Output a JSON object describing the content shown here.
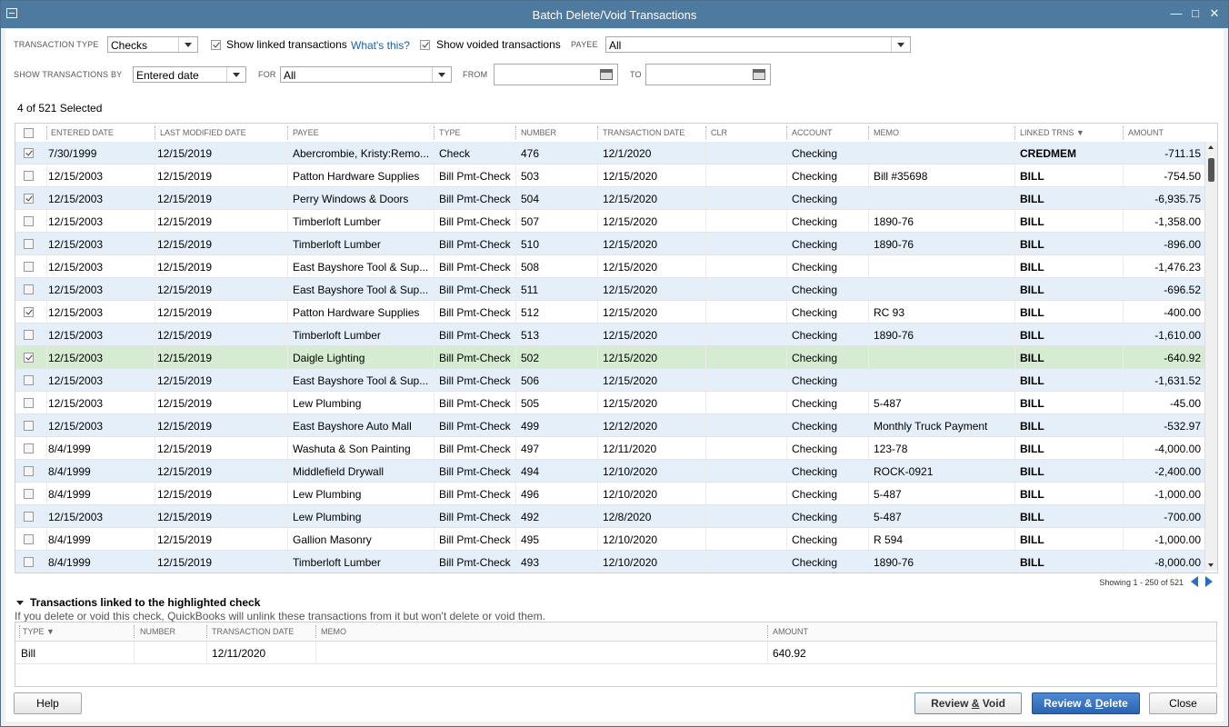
{
  "window": {
    "title": "Batch Delete/Void Transactions"
  },
  "filters": {
    "transaction_type_label": "TRANSACTION TYPE",
    "transaction_type_value": "Checks",
    "show_linked_label": "Show linked transactions",
    "show_linked_checked": true,
    "whats_this": "What's this?",
    "show_voided_label": "Show voided transactions",
    "show_voided_checked": true,
    "payee_label": "PAYEE",
    "payee_value": "All",
    "show_by_label": "SHOW TRANSACTIONS BY",
    "show_by_value": "Entered date",
    "for_label": "FOR",
    "for_value": "All",
    "from_label": "FROM",
    "from_value": "",
    "to_label": "TO",
    "to_value": ""
  },
  "selection_count": "4 of 521 Selected",
  "grid": {
    "headers": [
      "ENTERED DATE",
      "LAST MODIFIED DATE",
      "PAYEE",
      "TYPE",
      "NUMBER",
      "TRANSACTION DATE",
      "CLR",
      "ACCOUNT",
      "MEMO",
      "LINKED TRNS ▼",
      "AMOUNT"
    ],
    "rows": [
      {
        "checked": true,
        "entered": "7/30/1999",
        "modified": "12/15/2019",
        "payee": "Abercrombie, Kristy:Remo...",
        "type": "Check",
        "number": "476",
        "tdate": "12/1/2020",
        "clr": "",
        "account": "Checking",
        "memo": "",
        "linked": "CREDMEM",
        "amount": "-711.15"
      },
      {
        "checked": false,
        "entered": "12/15/2003",
        "modified": "12/15/2019",
        "payee": "Patton Hardware Supplies",
        "type": "Bill Pmt-Check",
        "number": "503",
        "tdate": "12/15/2020",
        "clr": "",
        "account": "Checking",
        "memo": "Bill #35698",
        "linked": "BILL",
        "amount": "-754.50"
      },
      {
        "checked": true,
        "entered": "12/15/2003",
        "modified": "12/15/2019",
        "payee": "Perry Windows & Doors",
        "type": "Bill Pmt-Check",
        "number": "504",
        "tdate": "12/15/2020",
        "clr": "",
        "account": "Checking",
        "memo": "",
        "linked": "BILL",
        "amount": "-6,935.75"
      },
      {
        "checked": false,
        "entered": "12/15/2003",
        "modified": "12/15/2019",
        "payee": "Timberloft Lumber",
        "type": "Bill Pmt-Check",
        "number": "507",
        "tdate": "12/15/2020",
        "clr": "",
        "account": "Checking",
        "memo": "1890-76",
        "linked": "BILL",
        "amount": "-1,358.00"
      },
      {
        "checked": false,
        "entered": "12/15/2003",
        "modified": "12/15/2019",
        "payee": "Timberloft Lumber",
        "type": "Bill Pmt-Check",
        "number": "510",
        "tdate": "12/15/2020",
        "clr": "",
        "account": "Checking",
        "memo": "1890-76",
        "linked": "BILL",
        "amount": "-896.00"
      },
      {
        "checked": false,
        "entered": "12/15/2003",
        "modified": "12/15/2019",
        "payee": "East Bayshore Tool & Sup...",
        "type": "Bill Pmt-Check",
        "number": "508",
        "tdate": "12/15/2020",
        "clr": "",
        "account": "Checking",
        "memo": "",
        "linked": "BILL",
        "amount": "-1,476.23"
      },
      {
        "checked": false,
        "entered": "12/15/2003",
        "modified": "12/15/2019",
        "payee": "East Bayshore Tool & Sup...",
        "type": "Bill Pmt-Check",
        "number": "511",
        "tdate": "12/15/2020",
        "clr": "",
        "account": "Checking",
        "memo": "",
        "linked": "BILL",
        "amount": "-696.52"
      },
      {
        "checked": true,
        "entered": "12/15/2003",
        "modified": "12/15/2019",
        "payee": "Patton Hardware Supplies",
        "type": "Bill Pmt-Check",
        "number": "512",
        "tdate": "12/15/2020",
        "clr": "",
        "account": "Checking",
        "memo": "RC 93",
        "linked": "BILL",
        "amount": "-400.00"
      },
      {
        "checked": false,
        "entered": "12/15/2003",
        "modified": "12/15/2019",
        "payee": "Timberloft Lumber",
        "type": "Bill Pmt-Check",
        "number": "513",
        "tdate": "12/15/2020",
        "clr": "",
        "account": "Checking",
        "memo": "1890-76",
        "linked": "BILL",
        "amount": "-1,610.00"
      },
      {
        "checked": true,
        "entered": "12/15/2003",
        "modified": "12/15/2019",
        "payee": "Daigle Lighting",
        "type": "Bill Pmt-Check",
        "number": "502",
        "tdate": "12/15/2020",
        "clr": "",
        "account": "Checking",
        "memo": "",
        "linked": "BILL",
        "amount": "-640.92",
        "highlight": true
      },
      {
        "checked": false,
        "entered": "12/15/2003",
        "modified": "12/15/2019",
        "payee": "East Bayshore Tool & Sup...",
        "type": "Bill Pmt-Check",
        "number": "506",
        "tdate": "12/15/2020",
        "clr": "",
        "account": "Checking",
        "memo": "",
        "linked": "BILL",
        "amount": "-1,631.52"
      },
      {
        "checked": false,
        "entered": "12/15/2003",
        "modified": "12/15/2019",
        "payee": "Lew Plumbing",
        "type": "Bill Pmt-Check",
        "number": "505",
        "tdate": "12/15/2020",
        "clr": "",
        "account": "Checking",
        "memo": "5-487",
        "linked": "BILL",
        "amount": "-45.00"
      },
      {
        "checked": false,
        "entered": "12/15/2003",
        "modified": "12/15/2019",
        "payee": "East Bayshore Auto Mall",
        "type": "Bill Pmt-Check",
        "number": "499",
        "tdate": "12/12/2020",
        "clr": "",
        "account": "Checking",
        "memo": "Monthly Truck Payment",
        "linked": "BILL",
        "amount": "-532.97"
      },
      {
        "checked": false,
        "entered": "8/4/1999",
        "modified": "12/15/2019",
        "payee": "Washuta & Son Painting",
        "type": "Bill Pmt-Check",
        "number": "497",
        "tdate": "12/11/2020",
        "clr": "",
        "account": "Checking",
        "memo": "123-78",
        "linked": "BILL",
        "amount": "-4,000.00"
      },
      {
        "checked": false,
        "entered": "8/4/1999",
        "modified": "12/15/2019",
        "payee": "Middlefield Drywall",
        "type": "Bill Pmt-Check",
        "number": "494",
        "tdate": "12/10/2020",
        "clr": "",
        "account": "Checking",
        "memo": "ROCK-0921",
        "linked": "BILL",
        "amount": "-2,400.00"
      },
      {
        "checked": false,
        "entered": "8/4/1999",
        "modified": "12/15/2019",
        "payee": "Lew Plumbing",
        "type": "Bill Pmt-Check",
        "number": "496",
        "tdate": "12/10/2020",
        "clr": "",
        "account": "Checking",
        "memo": "5-487",
        "linked": "BILL",
        "amount": "-1,000.00"
      },
      {
        "checked": false,
        "entered": "12/15/2003",
        "modified": "12/15/2019",
        "payee": "Lew Plumbing",
        "type": "Bill Pmt-Check",
        "number": "492",
        "tdate": "12/8/2020",
        "clr": "",
        "account": "Checking",
        "memo": "5-487",
        "linked": "BILL",
        "amount": "-700.00"
      },
      {
        "checked": false,
        "entered": "8/4/1999",
        "modified": "12/15/2019",
        "payee": "Gallion Masonry",
        "type": "Bill Pmt-Check",
        "number": "495",
        "tdate": "12/10/2020",
        "clr": "",
        "account": "Checking",
        "memo": "R 594",
        "linked": "BILL",
        "amount": "-1,000.00"
      },
      {
        "checked": false,
        "entered": "8/4/1999",
        "modified": "12/15/2019",
        "payee": "Timberloft Lumber",
        "type": "Bill Pmt-Check",
        "number": "493",
        "tdate": "12/10/2020",
        "clr": "",
        "account": "Checking",
        "memo": "1890-76",
        "linked": "BILL",
        "amount": "-8,000.00"
      }
    ]
  },
  "pager": {
    "text": "Showing 1 - 250 of 521"
  },
  "linked": {
    "title": "Transactions linked to the highlighted check",
    "note": "If you delete or void this check, QuickBooks will unlink these transactions from it but won't delete or void them.",
    "headers": [
      "TYPE ▼",
      "NUMBER",
      "TRANSACTION DATE",
      "MEMO",
      "AMOUNT"
    ],
    "rows": [
      {
        "type": "Bill",
        "number": "",
        "tdate": "12/11/2020",
        "memo": "",
        "amount": "640.92"
      }
    ]
  },
  "buttons": {
    "help": "Help",
    "review_void_pre": "Review ",
    "review_void_acc": "&",
    "review_void_post": " Void",
    "review_delete_pre": "Review & ",
    "review_delete_acc": "D",
    "review_delete_post": "elete",
    "close": "Close"
  },
  "colors": {
    "titlebar": "#4e7aa0",
    "row_alt": "#e5effa",
    "row_highlight": "#d5ebd2",
    "primary_button": "#2b63b0",
    "link": "#1f5fae"
  },
  "icons": [
    "system-menu-icon",
    "minimize-icon",
    "maximize-icon",
    "close-icon",
    "calendar-icon",
    "dropdown-arrow-icon",
    "prev-page-icon",
    "next-page-icon",
    "collapse-triangle-icon"
  ]
}
